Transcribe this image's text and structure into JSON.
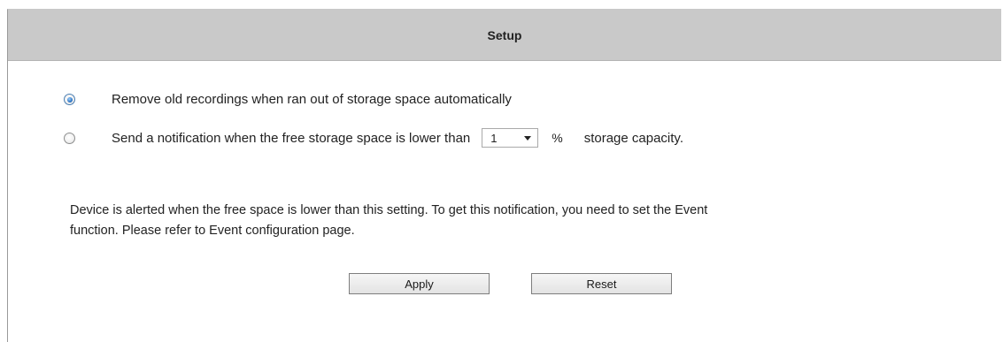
{
  "header": {
    "title": "Setup"
  },
  "options": {
    "remove_old": {
      "label": "Remove old recordings when ran out of storage space automatically",
      "checked": true
    },
    "notify": {
      "label_prefix": "Send a notification when the free storage space is lower than",
      "threshold_value": "1",
      "percent_symbol": "%",
      "label_suffix": "storage capacity.",
      "checked": false
    }
  },
  "info": {
    "line1": "Device is alerted when the free space is lower than this setting. To get this notification, you need to set the Event",
    "line2": "function. Please refer to Event configuration page."
  },
  "buttons": {
    "apply_label": "Apply",
    "reset_label": "Reset"
  }
}
